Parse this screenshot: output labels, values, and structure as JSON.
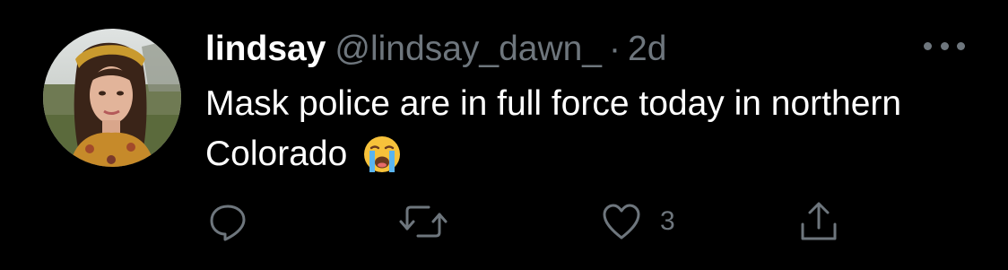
{
  "tweet": {
    "display_name": "lindsay",
    "handle": "@lindsay_dawn_",
    "separator": "·",
    "time": "2d",
    "text": "Mask police are in full force today in northern Colorado",
    "emoji": "loudly-crying-face"
  },
  "actions": {
    "reply_icon": "reply-icon",
    "retweet_icon": "retweet-icon",
    "like_icon": "heart-icon",
    "like_count": "3",
    "share_icon": "share-icon"
  },
  "colors": {
    "background": "#000000",
    "text": "#ffffff",
    "secondary": "#6e767d"
  }
}
